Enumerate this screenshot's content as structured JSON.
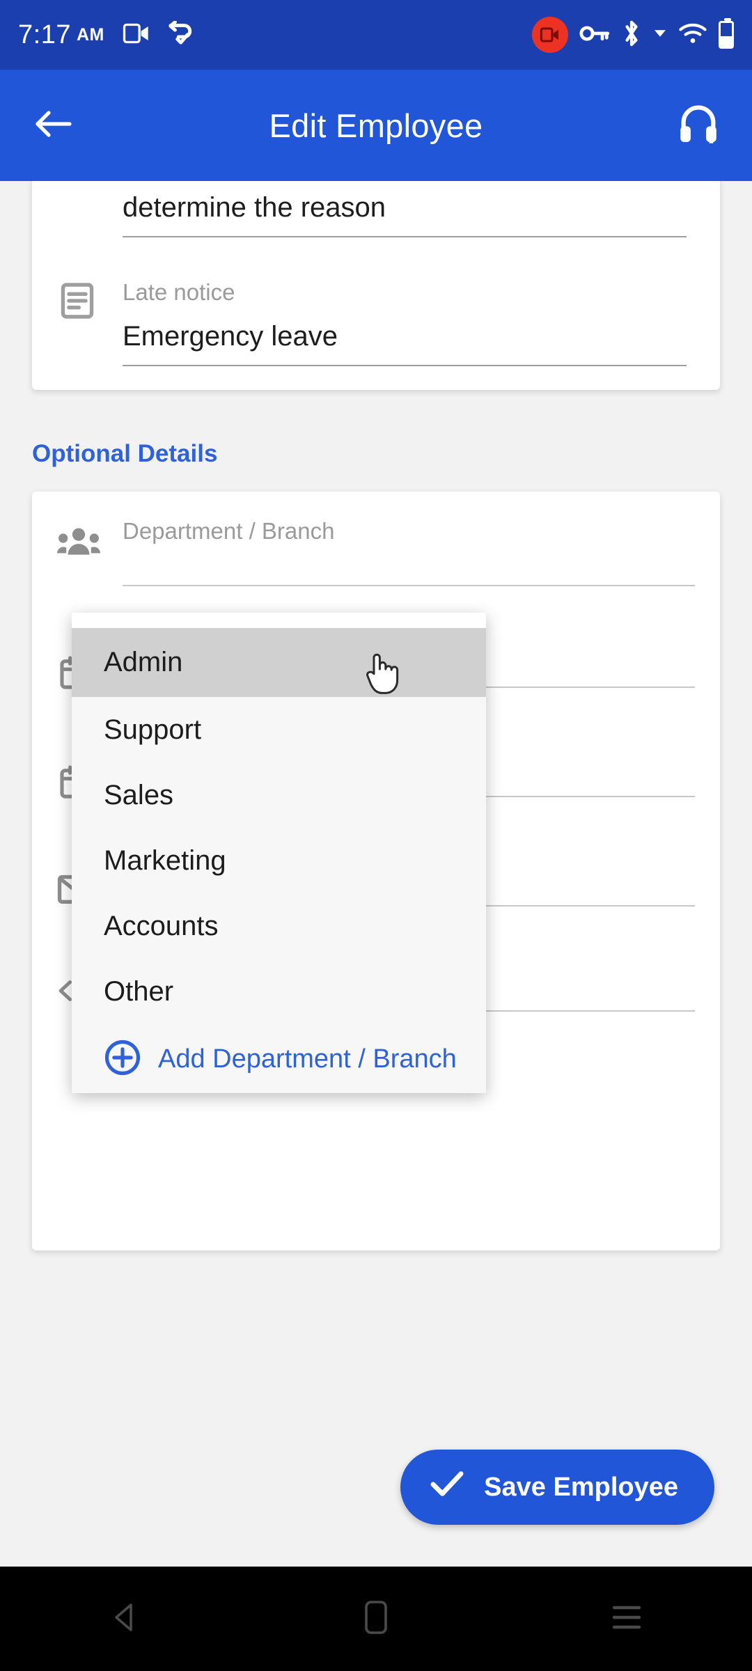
{
  "status_bar": {
    "time": "7:17",
    "ampm": "AM",
    "icons": [
      "video-camera-icon",
      "android-auto-icon",
      "screen-recording-icon",
      "vpn-key-icon",
      "bluetooth-icon",
      "wifi-icon",
      "battery-icon"
    ],
    "background": "#1b3faf"
  },
  "app_bar": {
    "title": "Edit Employee",
    "back_icon": "arrow-back-icon",
    "support_icon": "headset-icon",
    "background": "#2256d9"
  },
  "form": {
    "reason_field": {
      "value": "determine the reason"
    },
    "late_notice_field": {
      "icon": "notes-icon",
      "label": "Late notice",
      "value": "Emergency leave"
    }
  },
  "optional_section": {
    "title": "Optional Details",
    "title_color": "#2f62d8",
    "fields": [
      {
        "icon": "people-group-icon",
        "label": "Department / Branch"
      },
      {
        "icon": "calendar-icon",
        "label": ""
      },
      {
        "icon": "calendar-icon",
        "label": ""
      },
      {
        "icon": "mail-icon",
        "label": ""
      },
      {
        "icon": "code-icon",
        "label": ""
      }
    ]
  },
  "dropdown": {
    "selected": "Admin",
    "options": [
      "Admin",
      "Support",
      "Sales",
      "Marketing",
      "Accounts",
      "Other"
    ],
    "add_action": {
      "icon": "add-circle-icon",
      "label": "Add Department / Branch",
      "color": "#2f62d8"
    },
    "highlight_color": "#d0d0d0",
    "background": "#f7f7f7"
  },
  "save_button": {
    "label": "Save Employee",
    "icon": "check-icon",
    "color": "#2256d9"
  },
  "nav_bar": {
    "back_icon": "nav-back-icon",
    "home_icon": "nav-home-icon",
    "recents_icon": "nav-recents-icon"
  }
}
